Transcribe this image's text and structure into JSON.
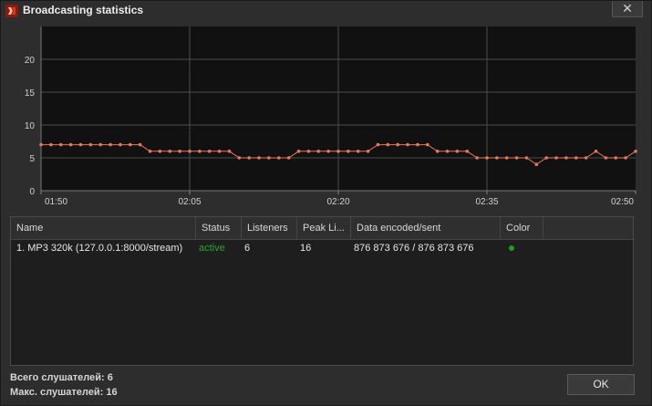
{
  "window": {
    "title": "Broadcasting statistics",
    "close_label": "✕"
  },
  "chart_data": {
    "type": "line",
    "title": "",
    "xlabel": "",
    "ylabel": "",
    "ylim": [
      0,
      25
    ],
    "yticks": [
      "0",
      "5",
      "10",
      "15",
      "20"
    ],
    "xticks": [
      "01:50",
      "02:05",
      "02:20",
      "02:35",
      "02:50"
    ],
    "grid": true,
    "line_color": "#e8785a",
    "x": [
      "01:50",
      "01:51",
      "01:52",
      "01:53",
      "01:54",
      "01:55",
      "01:56",
      "01:57",
      "01:58",
      "01:59",
      "02:00",
      "02:01",
      "02:02",
      "02:03",
      "02:04",
      "02:05",
      "02:06",
      "02:07",
      "02:08",
      "02:09",
      "02:10",
      "02:11",
      "02:12",
      "02:13",
      "02:14",
      "02:15",
      "02:16",
      "02:17",
      "02:18",
      "02:19",
      "02:20",
      "02:21",
      "02:22",
      "02:23",
      "02:24",
      "02:25",
      "02:26",
      "02:27",
      "02:28",
      "02:29",
      "02:30",
      "02:31",
      "02:32",
      "02:33",
      "02:34",
      "02:35",
      "02:36",
      "02:37",
      "02:38",
      "02:39",
      "02:40",
      "02:41",
      "02:42",
      "02:43",
      "02:44",
      "02:45",
      "02:46",
      "02:47",
      "02:48",
      "02:49",
      "02:50"
    ],
    "series": [
      {
        "values": [
          7,
          7,
          7,
          7,
          7,
          7,
          7,
          7,
          7,
          7,
          7,
          6,
          6,
          6,
          6,
          6,
          6,
          6,
          6,
          6,
          5,
          5,
          5,
          5,
          5,
          5,
          6,
          6,
          6,
          6,
          6,
          6,
          6,
          6,
          7,
          7,
          7,
          7,
          7,
          7,
          6,
          6,
          6,
          6,
          5,
          5,
          5,
          5,
          5,
          5,
          4,
          5,
          5,
          5,
          5,
          5,
          6,
          5,
          5,
          5,
          6
        ]
      }
    ]
  },
  "table": {
    "columns": [
      "Name",
      "Status",
      "Listeners",
      "Peak Li...",
      "Data encoded/sent",
      "Color"
    ],
    "rows": [
      {
        "name": "1. MP3 320k (127.0.0.1:8000/stream)",
        "status": "active",
        "listeners": "6",
        "peak": "16",
        "data": "876 873 676 / 876 873 676",
        "color": "#1f9e1f"
      }
    ]
  },
  "summary": {
    "total_label": "Всего слушателей:",
    "total_value": "6",
    "max_label": "Макс. слушателей:",
    "max_value": "16"
  },
  "buttons": {
    "ok_label": "OK"
  },
  "colors": {
    "status_active": "#2ea42e",
    "chart_bg": "#111111",
    "grid": "#4a4a4a"
  }
}
